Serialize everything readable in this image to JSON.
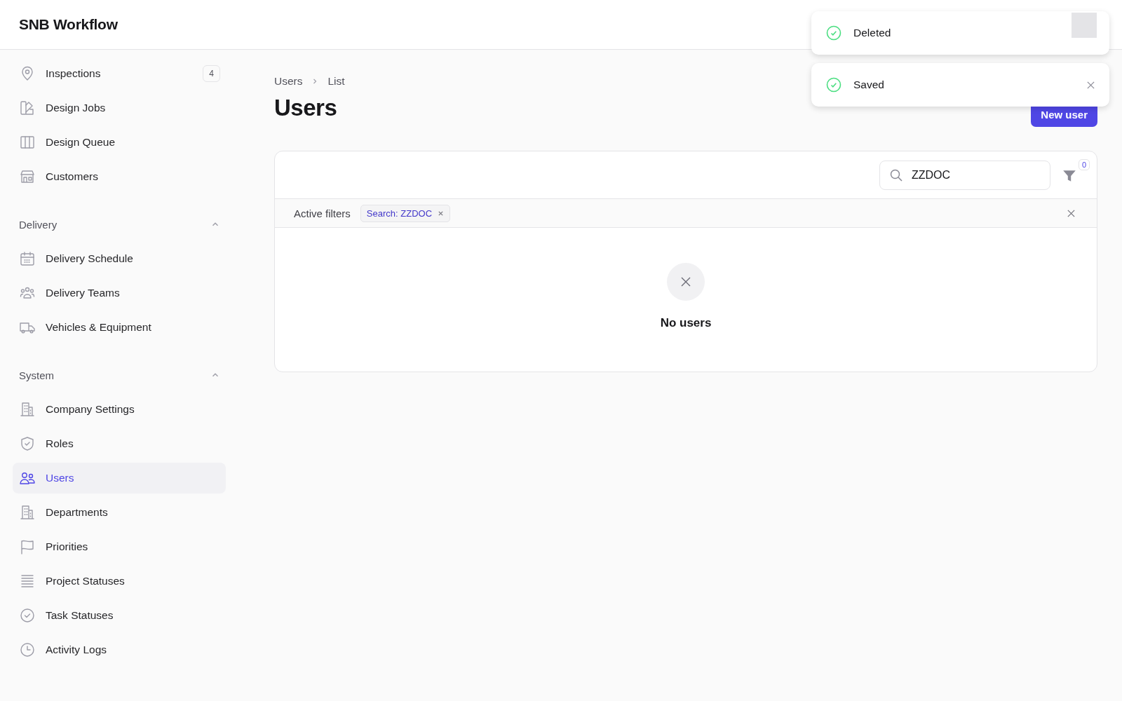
{
  "app": {
    "title": "SNB Workflow"
  },
  "sidebar": {
    "groups": [
      {
        "items": [
          {
            "label": "Inspections",
            "badge": "4",
            "selected": false
          },
          {
            "label": "Design Jobs",
            "selected": false
          },
          {
            "label": "Design Queue",
            "selected": false
          },
          {
            "label": "Customers",
            "selected": false
          }
        ]
      },
      {
        "title": "Delivery",
        "expanded": true,
        "items": [
          {
            "label": "Delivery Schedule",
            "selected": false
          },
          {
            "label": "Delivery Teams",
            "selected": false
          },
          {
            "label": "Vehicles & Equipment",
            "selected": false
          }
        ]
      },
      {
        "title": "System",
        "expanded": true,
        "items": [
          {
            "label": "Company Settings",
            "selected": false
          },
          {
            "label": "Roles",
            "selected": false
          },
          {
            "label": "Users",
            "selected": true
          },
          {
            "label": "Departments",
            "selected": false
          },
          {
            "label": "Priorities",
            "selected": false
          },
          {
            "label": "Project Statuses",
            "selected": false
          },
          {
            "label": "Task Statuses",
            "selected": false
          },
          {
            "label": "Activity Logs",
            "selected": false
          }
        ]
      }
    ]
  },
  "breadcrumb": [
    "Users",
    "List"
  ],
  "page": {
    "title": "Users",
    "primary_button": "New user"
  },
  "table": {
    "search": {
      "value": "ZZDOC"
    },
    "filter_count": "0",
    "active_filters_label": "Active filters",
    "filters": [
      {
        "label": "Search: ZZDOC"
      }
    ],
    "empty_message": "No users"
  },
  "toasts": [
    {
      "message": "Deleted",
      "close_button": false
    },
    {
      "message": "Saved",
      "close_button": true
    }
  ]
}
